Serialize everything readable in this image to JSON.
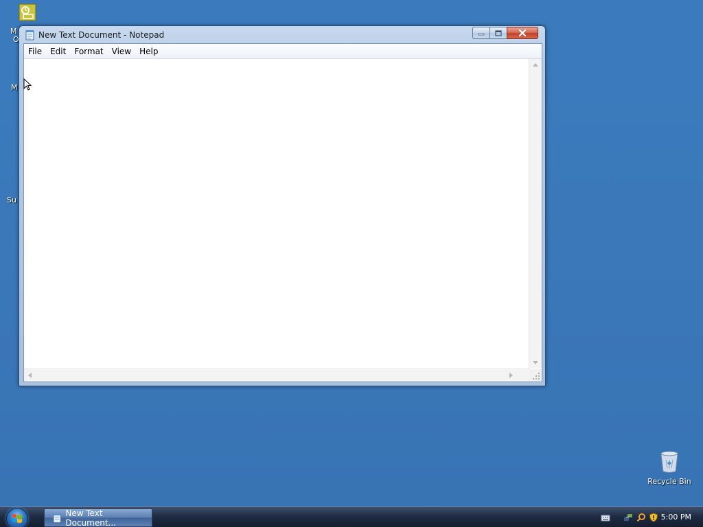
{
  "desktop": {
    "icons": [
      {
        "label": "Recycle Bin",
        "icon": "recycle-bin-icon"
      }
    ],
    "partial_labels": [
      "M",
      "O",
      "M",
      "Su"
    ]
  },
  "notepad": {
    "title": "New Text Document - Notepad",
    "menu": [
      "File",
      "Edit",
      "Format",
      "View",
      "Help"
    ],
    "content": ""
  },
  "taskbar": {
    "start_label": "Start",
    "task_button_label": "New Text Document...",
    "clock": "5:00 PM"
  },
  "colors": {
    "desktop": "#3a78b9",
    "taskbar": "#1e2b42",
    "close_button": "#c24128"
  }
}
